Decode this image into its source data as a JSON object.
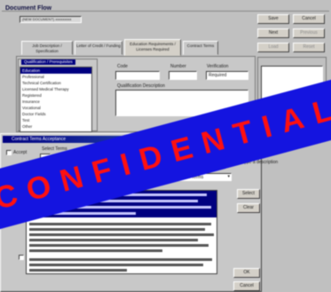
{
  "window": {
    "title": "Document Flow",
    "subtitle": "(NEW DOCUMENT) xxxxxxxxx"
  },
  "side_buttons": [
    "Save",
    "Cancel",
    "Next",
    "Previous",
    "Load",
    "Reset"
  ],
  "tabs": [
    "Job Description / Specification",
    "Letter of Credit / Funding",
    "Education Requirements / Licenses Required",
    "Contract Terms"
  ],
  "active_tab_index": 2,
  "group": {
    "title": "Qualification / Prerequisites",
    "list_items": [
      "Education",
      "Professional",
      "Technical Certification",
      "Licensed Medical Therapy",
      "Registered",
      "Insurance",
      "Vocational",
      "Doctor Fields",
      "Test",
      "Other",
      "Self Employed",
      "Type"
    ],
    "selected_index": 0
  },
  "fields": {
    "code_label": "Code",
    "number_label": "Number",
    "description_label": "Qualification Description",
    "right_label": "Verification",
    "right_value": "Required"
  },
  "dialog": {
    "title": "Contract Terms Acceptance",
    "checkbox_label": "Accept",
    "select_label": "Select Terms",
    "dropdown_value": "Standard Terms",
    "options_label": "Select an option and type a description",
    "buttons": [
      "Select",
      "Clear",
      "OK",
      "Cancel"
    ]
  },
  "stamp": {
    "text": "CONFIDENTIAL",
    "background": "#1414e0",
    "color": "#ff1010"
  },
  "colors": {
    "titlebar": "#000080",
    "face": "#c0c0c0",
    "selection": "#000080"
  }
}
